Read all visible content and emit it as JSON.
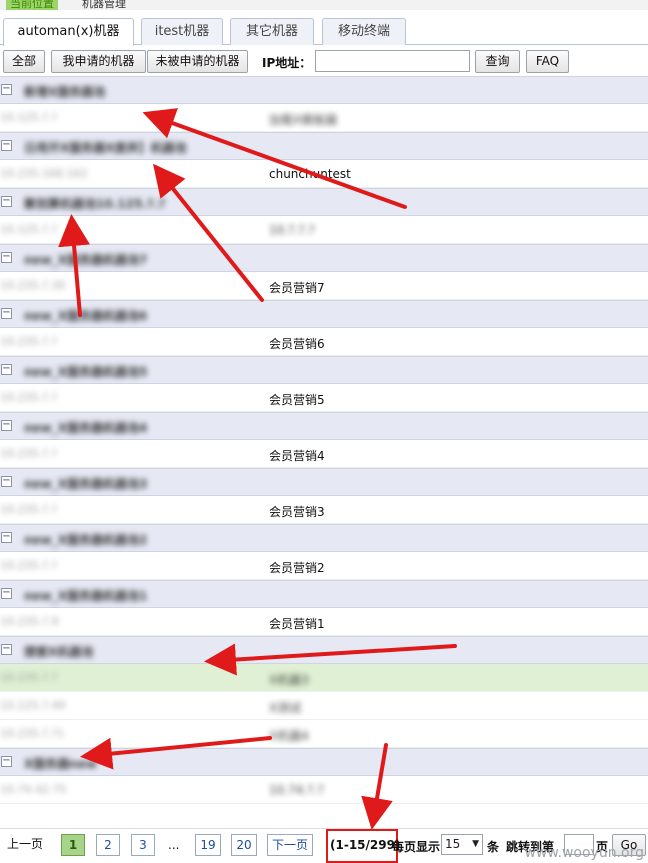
{
  "breadcrumb": {
    "location": "当前位置",
    "page": "机器管理"
  },
  "tabs": [
    {
      "label": "automan(x)机器",
      "active": true
    },
    {
      "label": "itest机器",
      "active": false
    },
    {
      "label": "其它机器",
      "active": false
    },
    {
      "label": "移动终端",
      "active": false
    }
  ],
  "toolbar": {
    "all_label": "全部",
    "mine_label": "我申请的机器",
    "not_mine_label": "未被申请的机器",
    "ip_label": "IP地址：",
    "ip_value": "",
    "search_label": "查询",
    "faq_label": "FAQ"
  },
  "list": {
    "rows": [
      {
        "type": "pool",
        "name": "新增X服务器池"
      },
      {
        "type": "machine",
        "ip": "10.125.?.?",
        "name": "加载X模板器"
      },
      {
        "type": "pool",
        "name": "日用开X服务器X废弃】机器池"
      },
      {
        "type": "machine",
        "ip": "10.235.168.162",
        "name": "chunchuntest"
      },
      {
        "type": "pool",
        "name": "聚划算机器池10.125.?.?"
      },
      {
        "type": "machine",
        "ip": "10.125.?.?",
        "name": "10.?.?.?"
      },
      {
        "type": "pool",
        "name": "new_X服务器机器池7"
      },
      {
        "type": "machine",
        "ip": "10.235.?.30",
        "name": "会员营销7"
      },
      {
        "type": "pool",
        "name": "new_X服务器机器池6"
      },
      {
        "type": "machine",
        "ip": "10.235.?.?",
        "name": "会员营销6"
      },
      {
        "type": "pool",
        "name": "new_X服务器机器池5"
      },
      {
        "type": "machine",
        "ip": "10.235.?.?",
        "name": "会员营销5"
      },
      {
        "type": "pool",
        "name": "new_X服务器机器池4"
      },
      {
        "type": "machine",
        "ip": "10.235.?.?",
        "name": "会员营销4"
      },
      {
        "type": "pool",
        "name": "new_X服务器机器池3"
      },
      {
        "type": "machine",
        "ip": "10.235.?.?",
        "name": "会员营销3"
      },
      {
        "type": "pool",
        "name": "new_X服务器机器池2"
      },
      {
        "type": "machine",
        "ip": "10.235.?.?",
        "name": "会员营销2"
      },
      {
        "type": "pool",
        "name": "new_X服务器机器池1"
      },
      {
        "type": "machine",
        "ip": "10.235.?.9",
        "name": "会员营销1"
      },
      {
        "type": "pool",
        "name": "搜索X机器池"
      },
      {
        "type": "machine",
        "ip": "10.235.?.?",
        "name": "X机器3",
        "highlight": true
      },
      {
        "type": "machine",
        "ip": "10.125.?.49",
        "name": "X测试",
        "highlight": false
      },
      {
        "type": "machine",
        "ip": "10.235.?.?1",
        "name": "X机器4",
        "highlight": false
      },
      {
        "type": "pool",
        "name": "X服务器new"
      },
      {
        "type": "machine",
        "ip": "10.74.42.75",
        "name": "10.74.?.?"
      }
    ]
  },
  "pager": {
    "prev": "上一页",
    "pages": [
      "1",
      "2",
      "3"
    ],
    "ellipsis": "...",
    "pages_tail": [
      "19",
      "20"
    ],
    "next": "下一页",
    "range": "(1-15/299)",
    "per_page_label": "每页显示",
    "per_page_value": "15",
    "unit": "条",
    "jump_label": "跳转到第",
    "jump_unit": "页",
    "go": "Go"
  },
  "watermark": "www.wooyun.org",
  "colors": {
    "accent_green": "#a6d58a",
    "pool_bg": "#e6e9f3",
    "annotation_red": "#e01a1a"
  }
}
